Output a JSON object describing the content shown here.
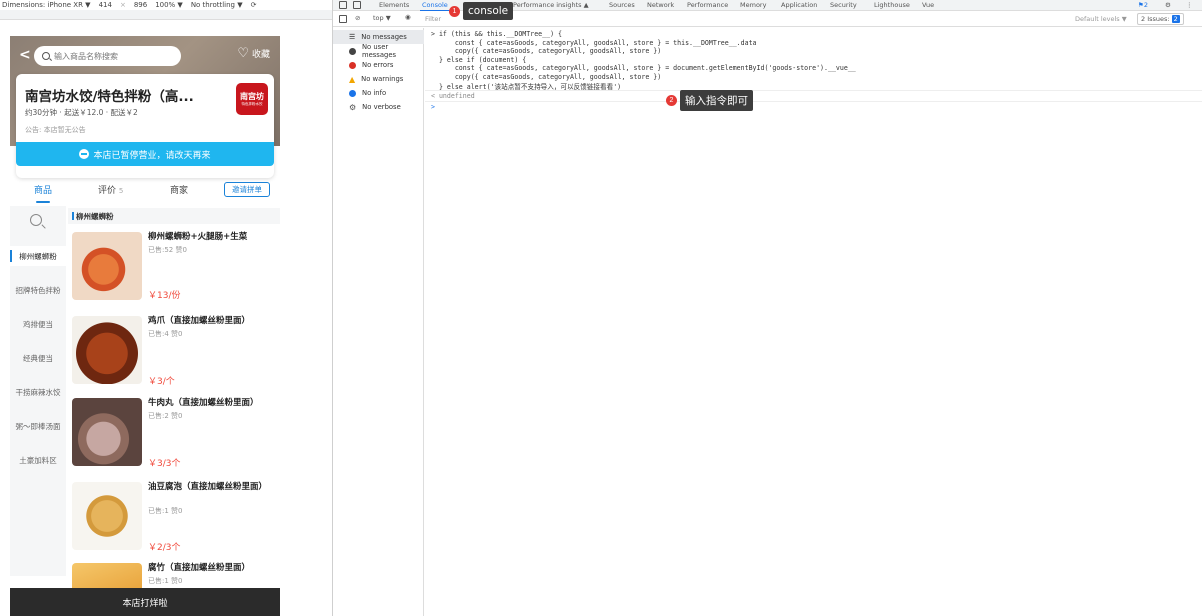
{
  "device_toolbar": {
    "device": "Dimensions: iPhone XR ▼",
    "width": "414",
    "times": "×",
    "height": "896",
    "zoom": "100% ▼",
    "throttle": "No throttling ▼"
  },
  "store": {
    "search_placeholder": "输入商品名称搜索",
    "favorite_label": "收藏",
    "name": "南宫坊水饺/特色拌粉（高...",
    "meta": "约30分钟 · 起送￥12.0 · 配送￥2",
    "notice": "公告: 本店暂无公告",
    "logo_text": "南宫坊",
    "logo_sub": "特色拌粉水饺",
    "closed_text": "本店已暂停营业，请改天再来"
  },
  "tabs": {
    "goods": "商品",
    "reviews": "评价",
    "reviews_count": "5",
    "merchant": "商家",
    "invite": "邀请拼单"
  },
  "sidebar": {
    "items": [
      "柳州螺蛳粉",
      "招牌特色拌粉",
      "鸡排便当",
      "经典便当",
      "干捞麻辣水饺",
      "粥～即棒汤面",
      "土豪加料区"
    ]
  },
  "category_header": "柳州螺蛳粉",
  "goods": [
    {
      "name": "柳州螺蛳粉+火腿肠+生菜",
      "sales": "已售:52 赞0",
      "price": "￥13/份"
    },
    {
      "name": "鸡爪（直接加螺丝粉里面）",
      "sales": "已售:4 赞0",
      "price": "￥3/个"
    },
    {
      "name": "牛肉丸（直接加螺丝粉里面）",
      "sales": "已售:2 赞0",
      "price": "￥3/3个"
    },
    {
      "name": "油豆腐泡（直接加螺丝粉里面）",
      "sales": "已售:1 赞0",
      "price": "￥2/3个"
    },
    {
      "name": "腐竹（直接加螺丝粉里面）",
      "sales": "已售:1 赞0",
      "price": ""
    }
  ],
  "bottom_bar": "本店打烊啦",
  "devtools": {
    "tabs": [
      "Elements",
      "Console",
      "Performance insights ▲",
      "Sources",
      "Network",
      "Performance",
      "Memory",
      "Application",
      "Security",
      "Lighthouse",
      "Vue"
    ],
    "context": "top ▼",
    "filter_placeholder": "Filter",
    "levels": "Default levels ▼",
    "issues_label": "2 Issues:",
    "issues_count": "2",
    "top_badge": "2",
    "sidebar": [
      "No messages",
      "No user messages",
      "No errors",
      "No warnings",
      "No info",
      "No verbose"
    ],
    "code": [
      "> if (this && this.__DOMTree__) {",
      "      const { cate=asGoods, categoryAll, goodsAll, store } = this.__DOMTree__.data",
      "      copy({ cate=asGoods, categoryAll, goodsAll, store })",
      "  } else if (document) {",
      "      const { cate=asGoods, categoryAll, goodsAll, store } = document.getElementById('goods-store').__vue__",
      "      copy({ cate=asGoods, categoryAll, goodsAll, store })",
      "  } else alert('该站点暂不支持导入，可以反馈链接看看')",
      "< undefined",
      ">"
    ],
    "callout1_num": "1",
    "callout1_text": "console",
    "callout2_num": "2",
    "callout2_text": "输入指令即可"
  },
  "colors": {
    "accent": "#1a82d8",
    "closed_bar": "#1fb6ef",
    "price": "#f04a3c",
    "callout_num": "#e53935",
    "tooltip": "#3d3d3d"
  }
}
